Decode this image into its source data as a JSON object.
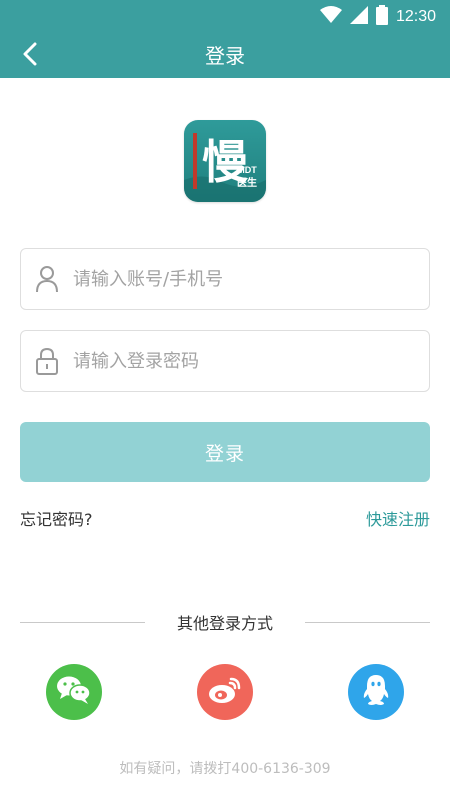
{
  "status_bar": {
    "time": "12:30",
    "icons": [
      "wifi-icon",
      "signal-icon",
      "battery-icon"
    ],
    "color": "#3b9f9f"
  },
  "app_bar": {
    "title": "登录",
    "back_icon": "chevron-left-icon",
    "color": "#3b9f9f"
  },
  "logo": {
    "main_char": "慢",
    "badge_top": "MDT",
    "badge_bottom": "医生"
  },
  "form": {
    "account": {
      "placeholder": "请输入账号/手机号",
      "value": "",
      "icon": "user-icon"
    },
    "password": {
      "placeholder": "请输入登录密码",
      "value": "",
      "icon": "lock-icon"
    },
    "login_label": "登录",
    "login_color": "#92d2d4"
  },
  "links": {
    "forgot": "忘记密码?",
    "register": "快速注册",
    "register_color": "#2d9a9a"
  },
  "other_login": {
    "label": "其他登录方式",
    "providers": [
      {
        "name": "wechat",
        "icon": "wechat-icon",
        "color": "#4cbf4a"
      },
      {
        "name": "weibo",
        "icon": "weibo-icon",
        "color": "#f0665a"
      },
      {
        "name": "qq",
        "icon": "qq-icon",
        "color": "#2fa5ea"
      }
    ]
  },
  "footer": {
    "hotline": "如有疑问，请拨打400-6136-309"
  }
}
